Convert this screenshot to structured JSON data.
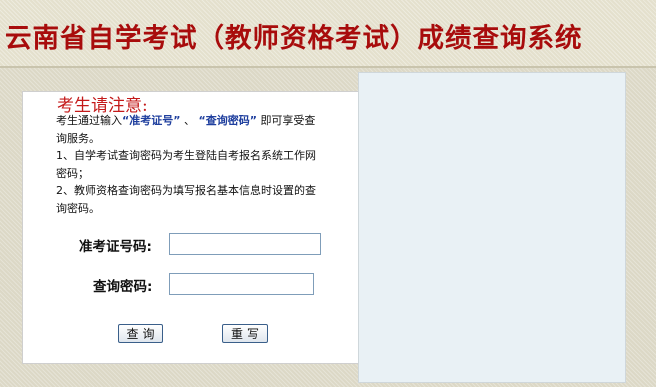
{
  "header": {
    "title": "云南省自学考试（教师资格考试）成绩查询系统"
  },
  "notice": {
    "heading": "考生请注意:",
    "intro_prefix": "考生通过输入",
    "intro_term1": "“准考证号”",
    "intro_separator": "、",
    "intro_term2": "“查询密码”",
    "intro_suffix": "即可享受查询服务。",
    "item1": "1、自学考试查询密码为考生登陆自考报名系统工作网密码；",
    "item2": "2、教师资格查询密码为填写报名基本信息时设置的查询密码。"
  },
  "form": {
    "exam_id_label": "准考证号码:",
    "exam_id_value": "",
    "password_label": "查询密码:",
    "password_value": "",
    "query_button": "查询",
    "reset_button": "重写"
  }
}
